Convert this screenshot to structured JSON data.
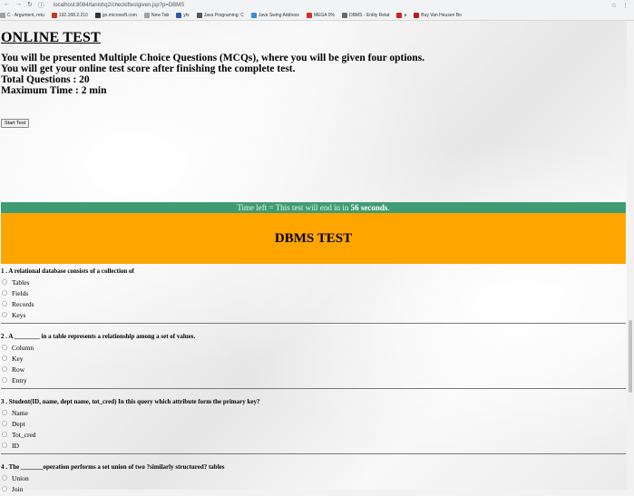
{
  "browser": {
    "url": "localhost:8084/tanishq2/checkiftestgiven.jsp?p=DBMS",
    "nav_icons": [
      "back-arrow-icon",
      "forward-arrow-icon",
      "reload-icon"
    ],
    "bookmarks": [
      {
        "label": "C - Argument, retu",
        "color": "#9aa0a6"
      },
      {
        "label": "192.168.2.210",
        "color": "#c0392b"
      },
      {
        "label": "go.microsoft.com",
        "color": "#333333"
      },
      {
        "label": "New Tab",
        "color": "#9aa0a6"
      },
      {
        "label": "yts",
        "color": "#2c5aa0"
      },
      {
        "label": "Java Programing: C",
        "color": "#555555"
      },
      {
        "label": "Java Swing Address",
        "color": "#3b8ad9"
      },
      {
        "label": "MEGA 0%",
        "color": "#d32f2f"
      },
      {
        "label": "DBMS - Entity Relat",
        "color": "#6a6a6a"
      },
      {
        "label": "a",
        "color": "#c62828"
      },
      {
        "label": "Buy Van Heusen Bo",
        "color": "#b71c1c"
      }
    ]
  },
  "intro": {
    "title": "ONLINE TEST",
    "line1": "You will be presented Multiple Choice Questions (MCQs), where you will be given four options.",
    "line2": "You will get your online test score after finishing the complete test.",
    "line3": "Total Questions : 20",
    "line4": "Maximum Time : 2 min"
  },
  "start_button": "Start Test",
  "timer": {
    "prefix": "Time left = This test will end in in ",
    "value": "56 seconds",
    "suffix": "."
  },
  "test_title": "DBMS TEST",
  "questions": [
    {
      "text": "1 . A relational database consists of a collection of",
      "options": [
        "Tables",
        "Fields",
        "Records",
        "Keys"
      ]
    },
    {
      "text": "2 . A ________ in a table represents a relationship among a set of values.",
      "options": [
        "Column",
        "Key",
        "Row",
        "Entry"
      ]
    },
    {
      "text": "3 . Student(ID, name, dept name, tot_cred) In this query which attribute form the primary key?",
      "options": [
        "Name",
        "Dept",
        "Tot_cred",
        "ID"
      ]
    },
    {
      "text": "4 . The _______operation performs a set union of two ?similarly structured? tables",
      "options": [
        "Union",
        "Join"
      ]
    }
  ]
}
